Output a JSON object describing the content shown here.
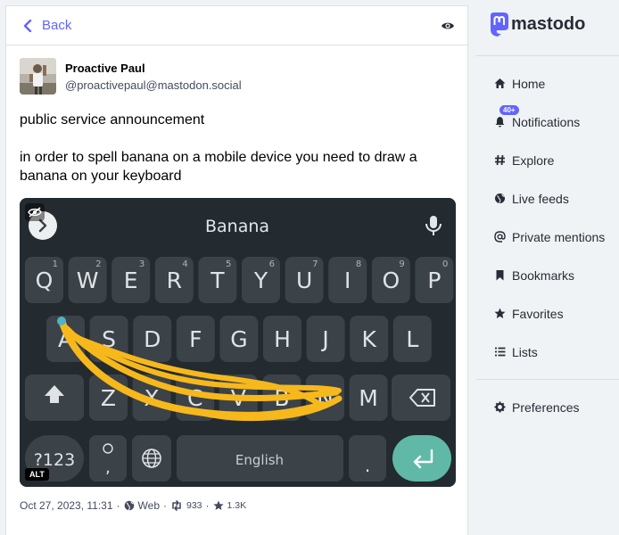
{
  "header": {
    "back_label": "Back"
  },
  "status": {
    "display_name": "Proactive Paul",
    "acct": "@proactivepaul@mastodon.social",
    "paragraphs": [
      "public service announcement",
      "in order to spell banana on a mobile device you need to draw a banana on your keyboard"
    ],
    "media": {
      "alt_badge": "ALT",
      "keyboard": {
        "suggestion": "Banana",
        "row1": [
          "Q",
          "W",
          "E",
          "R",
          "T",
          "Y",
          "U",
          "I",
          "O",
          "P"
        ],
        "row1_hints": [
          "1",
          "2",
          "3",
          "4",
          "5",
          "6",
          "7",
          "8",
          "9",
          "0"
        ],
        "row2": [
          "A",
          "S",
          "D",
          "F",
          "G",
          "H",
          "J",
          "K",
          "L"
        ],
        "row3": [
          "Z",
          "X",
          "C",
          "V",
          "B",
          "N",
          "M"
        ],
        "symbols_key": "?123",
        "comma_key": ",",
        "space_label": "English",
        "period_key": "."
      }
    },
    "meta": {
      "date": "Oct 27, 2023, 11:31",
      "sep1": "·",
      "application": "Web",
      "sep2": "·",
      "boosts": "933",
      "sep3": "·",
      "favourites": "1.3K"
    }
  },
  "sidebar": {
    "logo_text": "mastodon",
    "notifications_badge": "40+",
    "items": [
      {
        "label": "Home",
        "icon": "home-icon"
      },
      {
        "label": "Notifications",
        "icon": "bell-icon"
      },
      {
        "label": "Explore",
        "icon": "hashtag-icon"
      },
      {
        "label": "Live feeds",
        "icon": "globe-icon"
      },
      {
        "label": "Private mentions",
        "icon": "at-icon"
      },
      {
        "label": "Bookmarks",
        "icon": "bookmark-icon"
      },
      {
        "label": "Favorites",
        "icon": "star-icon"
      },
      {
        "label": "Lists",
        "icon": "list-icon"
      }
    ],
    "preferences_label": "Preferences"
  },
  "colors": {
    "accent": "#6364ff",
    "keyboard_bg": "#232a30",
    "key_bg": "#3b4349",
    "enter_key": "#5fb9a6",
    "swipe_trail": "#f7b81c"
  }
}
